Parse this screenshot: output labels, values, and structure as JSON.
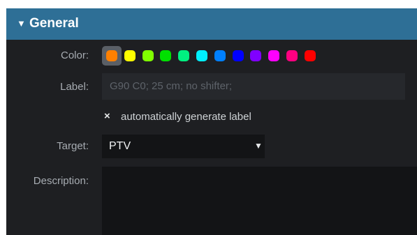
{
  "header": {
    "toggle_glyph": "▼",
    "title": "General"
  },
  "color": {
    "label": "Color:",
    "swatches": [
      "#ff8000",
      "#ffff00",
      "#80ff00",
      "#00e000",
      "#00f080",
      "#00f0ff",
      "#0080ff",
      "#0000ff",
      "#8000ff",
      "#ff00ff",
      "#ff0080",
      "#ff0000"
    ],
    "selected_index": 0
  },
  "label_field": {
    "label": "Label:",
    "placeholder": "G90 C0; 25 cm; no shifter;"
  },
  "auto_label": {
    "mark": "×",
    "text": "automatically generate label"
  },
  "target": {
    "label": "Target:",
    "value": "PTV",
    "arrow": "▼"
  },
  "description": {
    "label": "Description:"
  }
}
